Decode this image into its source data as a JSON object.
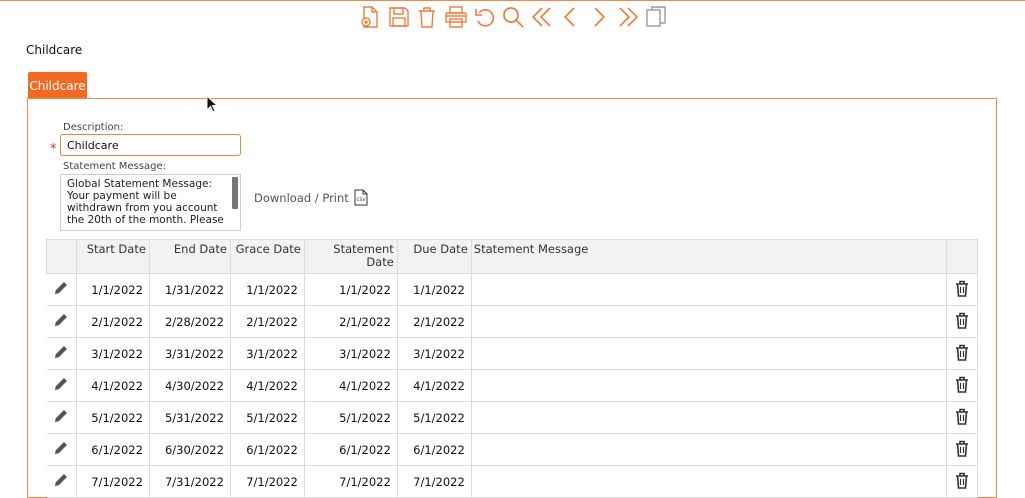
{
  "colors": {
    "accent": "#f26a21",
    "border": "#f08a4b",
    "required": "#e03030"
  },
  "toolbar": {
    "buttons": [
      {
        "icon": "new-document-icon"
      },
      {
        "icon": "save-icon"
      },
      {
        "icon": "delete-icon"
      },
      {
        "icon": "print-icon"
      },
      {
        "icon": "undo-icon"
      },
      {
        "icon": "search-icon"
      },
      {
        "icon": "first-record-icon"
      },
      {
        "icon": "previous-record-icon"
      },
      {
        "icon": "next-record-icon"
      },
      {
        "icon": "last-record-icon"
      },
      {
        "icon": "copy-icon"
      }
    ]
  },
  "page": {
    "title": "Childcare"
  },
  "tabs": [
    {
      "label": "Childcare"
    }
  ],
  "form": {
    "description_label": "Description:",
    "description_value": "Childcare",
    "statement_label": "Statement Message:",
    "statement_value": "Global Statement Message:\nYour payment will be\nwithdrawn from you account\nthe 20th of the month. Please",
    "download_label": "Download / Print"
  },
  "grid": {
    "headers": {
      "start_date": "Start Date",
      "end_date": "End Date",
      "grace_date": "Grace Date",
      "statement_date_1": "Statement",
      "statement_date_2": "Date",
      "due_date": "Due Date",
      "statement_message": "Statement Message"
    },
    "rows": [
      {
        "start": "1/1/2022",
        "end": "1/31/2022",
        "grace": "1/1/2022",
        "statement": "1/1/2022",
        "due": "1/1/2022",
        "message": ""
      },
      {
        "start": "2/1/2022",
        "end": "2/28/2022",
        "grace": "2/1/2022",
        "statement": "2/1/2022",
        "due": "2/1/2022",
        "message": ""
      },
      {
        "start": "3/1/2022",
        "end": "3/31/2022",
        "grace": "3/1/2022",
        "statement": "3/1/2022",
        "due": "3/1/2022",
        "message": ""
      },
      {
        "start": "4/1/2022",
        "end": "4/30/2022",
        "grace": "4/1/2022",
        "statement": "4/1/2022",
        "due": "4/1/2022",
        "message": ""
      },
      {
        "start": "5/1/2022",
        "end": "5/31/2022",
        "grace": "5/1/2022",
        "statement": "5/1/2022",
        "due": "5/1/2022",
        "message": ""
      },
      {
        "start": "6/1/2022",
        "end": "6/30/2022",
        "grace": "6/1/2022",
        "statement": "6/1/2022",
        "due": "6/1/2022",
        "message": ""
      },
      {
        "start": "7/1/2022",
        "end": "7/31/2022",
        "grace": "7/1/2022",
        "statement": "7/1/2022",
        "due": "7/1/2022",
        "message": ""
      }
    ]
  }
}
